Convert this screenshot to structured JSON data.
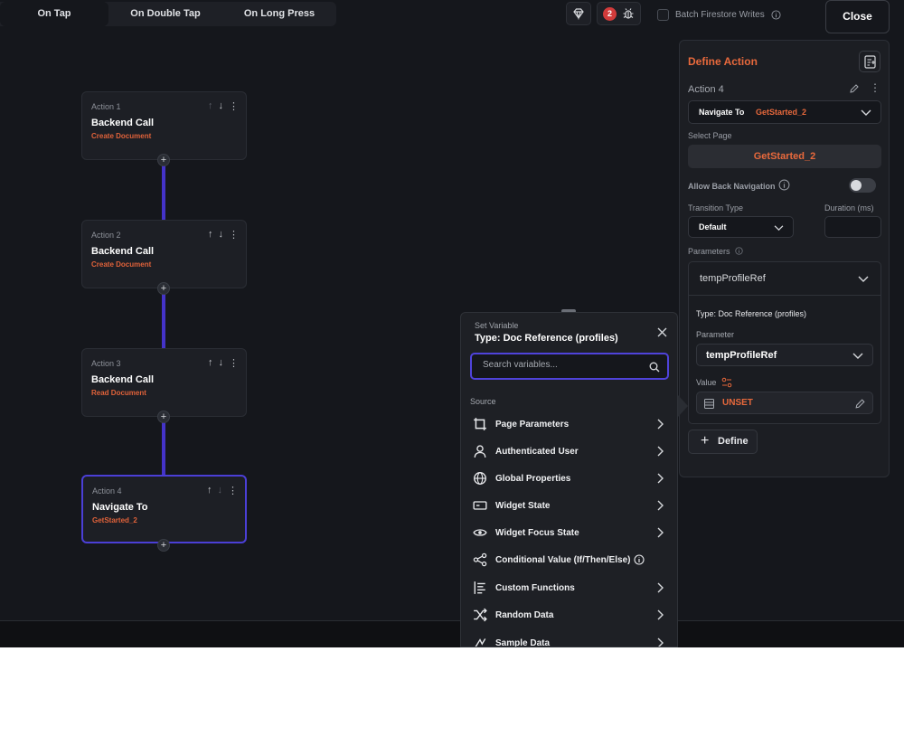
{
  "tabs": [
    "On Tap",
    "On Double Tap",
    "On Long Press"
  ],
  "toolbar": {
    "issues_count": "2",
    "batch_label": "Batch Firestore Writes",
    "close_label": "Close"
  },
  "actions": [
    {
      "label": "Action 1",
      "title": "Backend Call",
      "sub": "Create Document"
    },
    {
      "label": "Action 2",
      "title": "Backend Call",
      "sub": "Create Document"
    },
    {
      "label": "Action 3",
      "title": "Backend Call",
      "sub": "Read Document"
    },
    {
      "label": "Action 4",
      "title": "Navigate To",
      "sub": "GetStarted_2"
    }
  ],
  "panel": {
    "title": "Define Action",
    "action_label": "Action 4",
    "action_type": "Navigate To",
    "action_target": "GetStarted_2",
    "select_page_label": "Select Page",
    "selected_page": "GetStarted_2",
    "allow_back_label": "Allow Back Navigation",
    "transition_label": "Transition Type",
    "transition_value": "Default",
    "duration_label": "Duration (ms)",
    "parameters_label": "Parameters",
    "param_name": "tempProfileRef",
    "param_type": "Type: Doc Reference (profiles)",
    "parameter_label": "Parameter",
    "parameter_value": "tempProfileRef",
    "value_label": "Value",
    "value_state": "UNSET",
    "define_label": "Define"
  },
  "popup": {
    "label": "Set Variable",
    "title": "Type: Doc Reference (profiles)",
    "search_placeholder": "Search variables...",
    "source_label": "Source",
    "items": [
      "Page Parameters",
      "Authenticated User",
      "Global Properties",
      "Widget State",
      "Widget Focus State",
      "Conditional Value (If/Then/Else)",
      "Custom Functions",
      "Random Data",
      "Sample Data"
    ]
  },
  "colors": {
    "accent": "#e8693c",
    "selection": "#4b3fd6",
    "background": "#15171c"
  }
}
